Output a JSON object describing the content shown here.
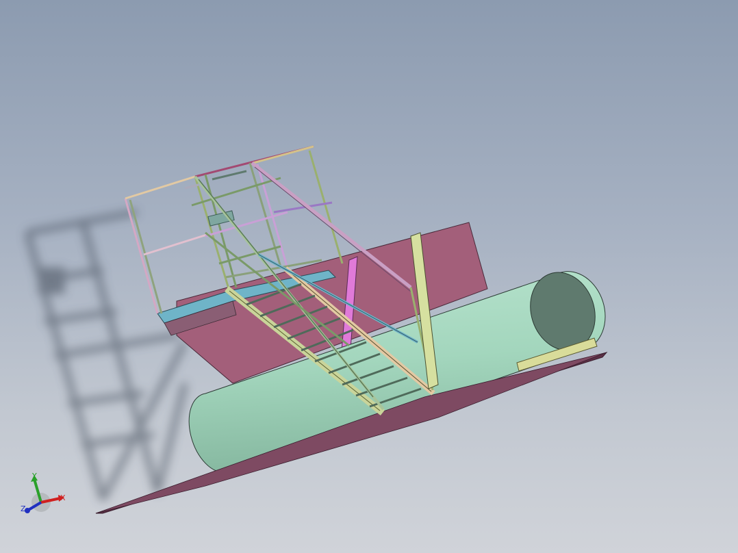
{
  "viewport": {
    "background_top": "#8c9bb0",
    "background_bottom": "#d0d3d9"
  },
  "colors": {
    "tank": "#a3d6bd",
    "tank_end": "#5f7a6e",
    "base_plate": "#7e4a62",
    "back_panel": "#a35f7a",
    "stair_stringer": "#c9d49a",
    "railing": "#9ab6a6",
    "platform_edge": "#6fb4c8",
    "magenta_post": "#e07ad8"
  },
  "triad": {
    "x_label": "X",
    "y_label": "Y",
    "z_label": "Z",
    "x_color": "#d02020",
    "y_color": "#20a020",
    "z_color": "#2030c0"
  }
}
